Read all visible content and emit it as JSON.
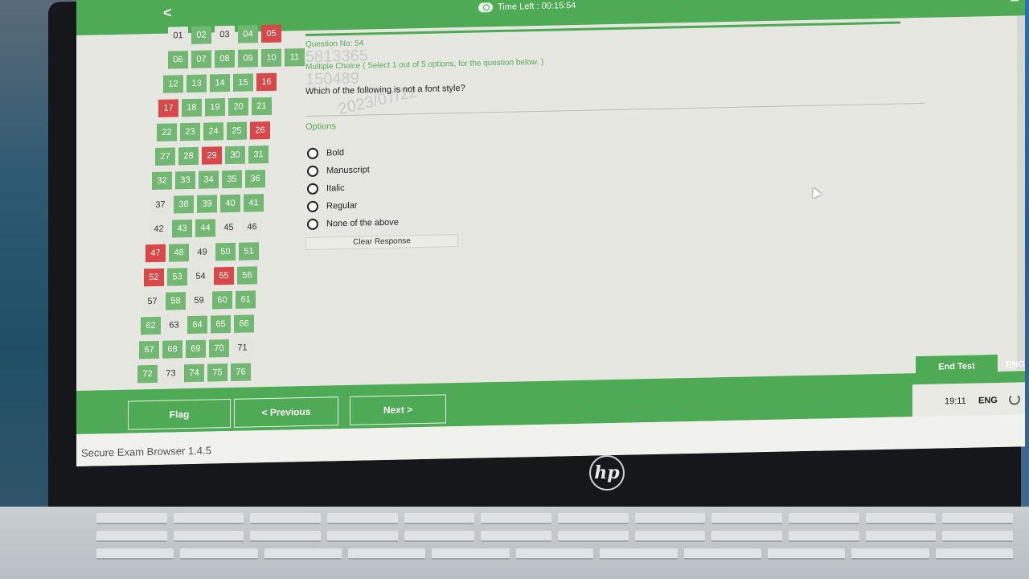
{
  "topbar": {
    "back_label": "<",
    "timer_text": "Time Left : 00:15:54"
  },
  "palette": {
    "rows": [
      [
        {
          "n": "01",
          "s": "grey"
        },
        {
          "n": "02",
          "s": "green"
        },
        {
          "n": "03",
          "s": "grey"
        },
        {
          "n": "04",
          "s": "green"
        },
        {
          "n": "05",
          "s": "red"
        }
      ],
      [
        {
          "n": "06",
          "s": "green"
        },
        {
          "n": "07",
          "s": "green"
        },
        {
          "n": "08",
          "s": "green"
        },
        {
          "n": "09",
          "s": "green"
        },
        {
          "n": "10",
          "s": "green"
        },
        {
          "n": "11",
          "s": "green"
        }
      ],
      [
        {
          "n": "12",
          "s": "green"
        },
        {
          "n": "13",
          "s": "green"
        },
        {
          "n": "14",
          "s": "green"
        },
        {
          "n": "15",
          "s": "green"
        },
        {
          "n": "16",
          "s": "red"
        }
      ],
      [
        {
          "n": "17",
          "s": "red"
        },
        {
          "n": "18",
          "s": "green"
        },
        {
          "n": "19",
          "s": "green"
        },
        {
          "n": "20",
          "s": "green"
        },
        {
          "n": "21",
          "s": "green"
        }
      ],
      [
        {
          "n": "22",
          "s": "green"
        },
        {
          "n": "23",
          "s": "green"
        },
        {
          "n": "24",
          "s": "green"
        },
        {
          "n": "25",
          "s": "green"
        },
        {
          "n": "26",
          "s": "red"
        }
      ],
      [
        {
          "n": "27",
          "s": "green"
        },
        {
          "n": "28",
          "s": "green"
        },
        {
          "n": "29",
          "s": "red"
        },
        {
          "n": "30",
          "s": "green"
        },
        {
          "n": "31",
          "s": "green"
        }
      ],
      [
        {
          "n": "32",
          "s": "green"
        },
        {
          "n": "33",
          "s": "green"
        },
        {
          "n": "34",
          "s": "green"
        },
        {
          "n": "35",
          "s": "green"
        },
        {
          "n": "36",
          "s": "green"
        }
      ],
      [
        {
          "n": "37",
          "s": "grey"
        },
        {
          "n": "38",
          "s": "green"
        },
        {
          "n": "39",
          "s": "green"
        },
        {
          "n": "40",
          "s": "green"
        },
        {
          "n": "41",
          "s": "green"
        }
      ],
      [
        {
          "n": "42",
          "s": "grey"
        },
        {
          "n": "43",
          "s": "green"
        },
        {
          "n": "44",
          "s": "green"
        },
        {
          "n": "45",
          "s": "grey"
        },
        {
          "n": "46",
          "s": "grey"
        }
      ],
      [
        {
          "n": "47",
          "s": "red"
        },
        {
          "n": "48",
          "s": "green"
        },
        {
          "n": "49",
          "s": "grey"
        },
        {
          "n": "50",
          "s": "green"
        },
        {
          "n": "51",
          "s": "green"
        }
      ],
      [
        {
          "n": "52",
          "s": "red"
        },
        {
          "n": "53",
          "s": "green"
        },
        {
          "n": "54",
          "s": "grey"
        },
        {
          "n": "55",
          "s": "red"
        },
        {
          "n": "56",
          "s": "green"
        }
      ],
      [
        {
          "n": "57",
          "s": "grey"
        },
        {
          "n": "58",
          "s": "green"
        },
        {
          "n": "59",
          "s": "grey"
        },
        {
          "n": "60",
          "s": "green"
        },
        {
          "n": "61",
          "s": "green"
        }
      ],
      [
        {
          "n": "62",
          "s": "green"
        },
        {
          "n": "63",
          "s": "grey"
        },
        {
          "n": "64",
          "s": "green"
        },
        {
          "n": "65",
          "s": "green"
        },
        {
          "n": "66",
          "s": "green"
        }
      ],
      [
        {
          "n": "67",
          "s": "green"
        },
        {
          "n": "68",
          "s": "green"
        },
        {
          "n": "69",
          "s": "green"
        },
        {
          "n": "70",
          "s": "green"
        },
        {
          "n": "71",
          "s": "grey"
        }
      ],
      [
        {
          "n": "72",
          "s": "green"
        },
        {
          "n": "73",
          "s": "grey"
        },
        {
          "n": "74",
          "s": "green"
        },
        {
          "n": "75",
          "s": "green"
        },
        {
          "n": "76",
          "s": "green"
        }
      ]
    ]
  },
  "question": {
    "number_label": "Question No: 54",
    "type_label": "Multiple Choice ( Select 1 out of 5 options, for the question below. )",
    "text": "Which of the following is not a font style?",
    "watermark": [
      "5813365",
      "150489",
      "2023/07/22"
    ],
    "options_heading": "Options",
    "options": [
      "Bold",
      "Manuscript",
      "Italic",
      "Regular",
      "None of the above"
    ],
    "clear_label": "Clear Response"
  },
  "footer": {
    "flag_label": "Flag",
    "previous_label": "< Previous",
    "next_label": "Next >",
    "end_test_label": "End Test",
    "lang_top": "ENG"
  },
  "taskbar": {
    "time": "19:11",
    "lang": "ENG"
  },
  "status": {
    "app_name": "Secure Exam Browser 1.4.5"
  },
  "device": {
    "brand": "hp"
  },
  "colors": {
    "green": "#4eaa54",
    "cell_green": "#72b872",
    "red": "#d84848"
  }
}
